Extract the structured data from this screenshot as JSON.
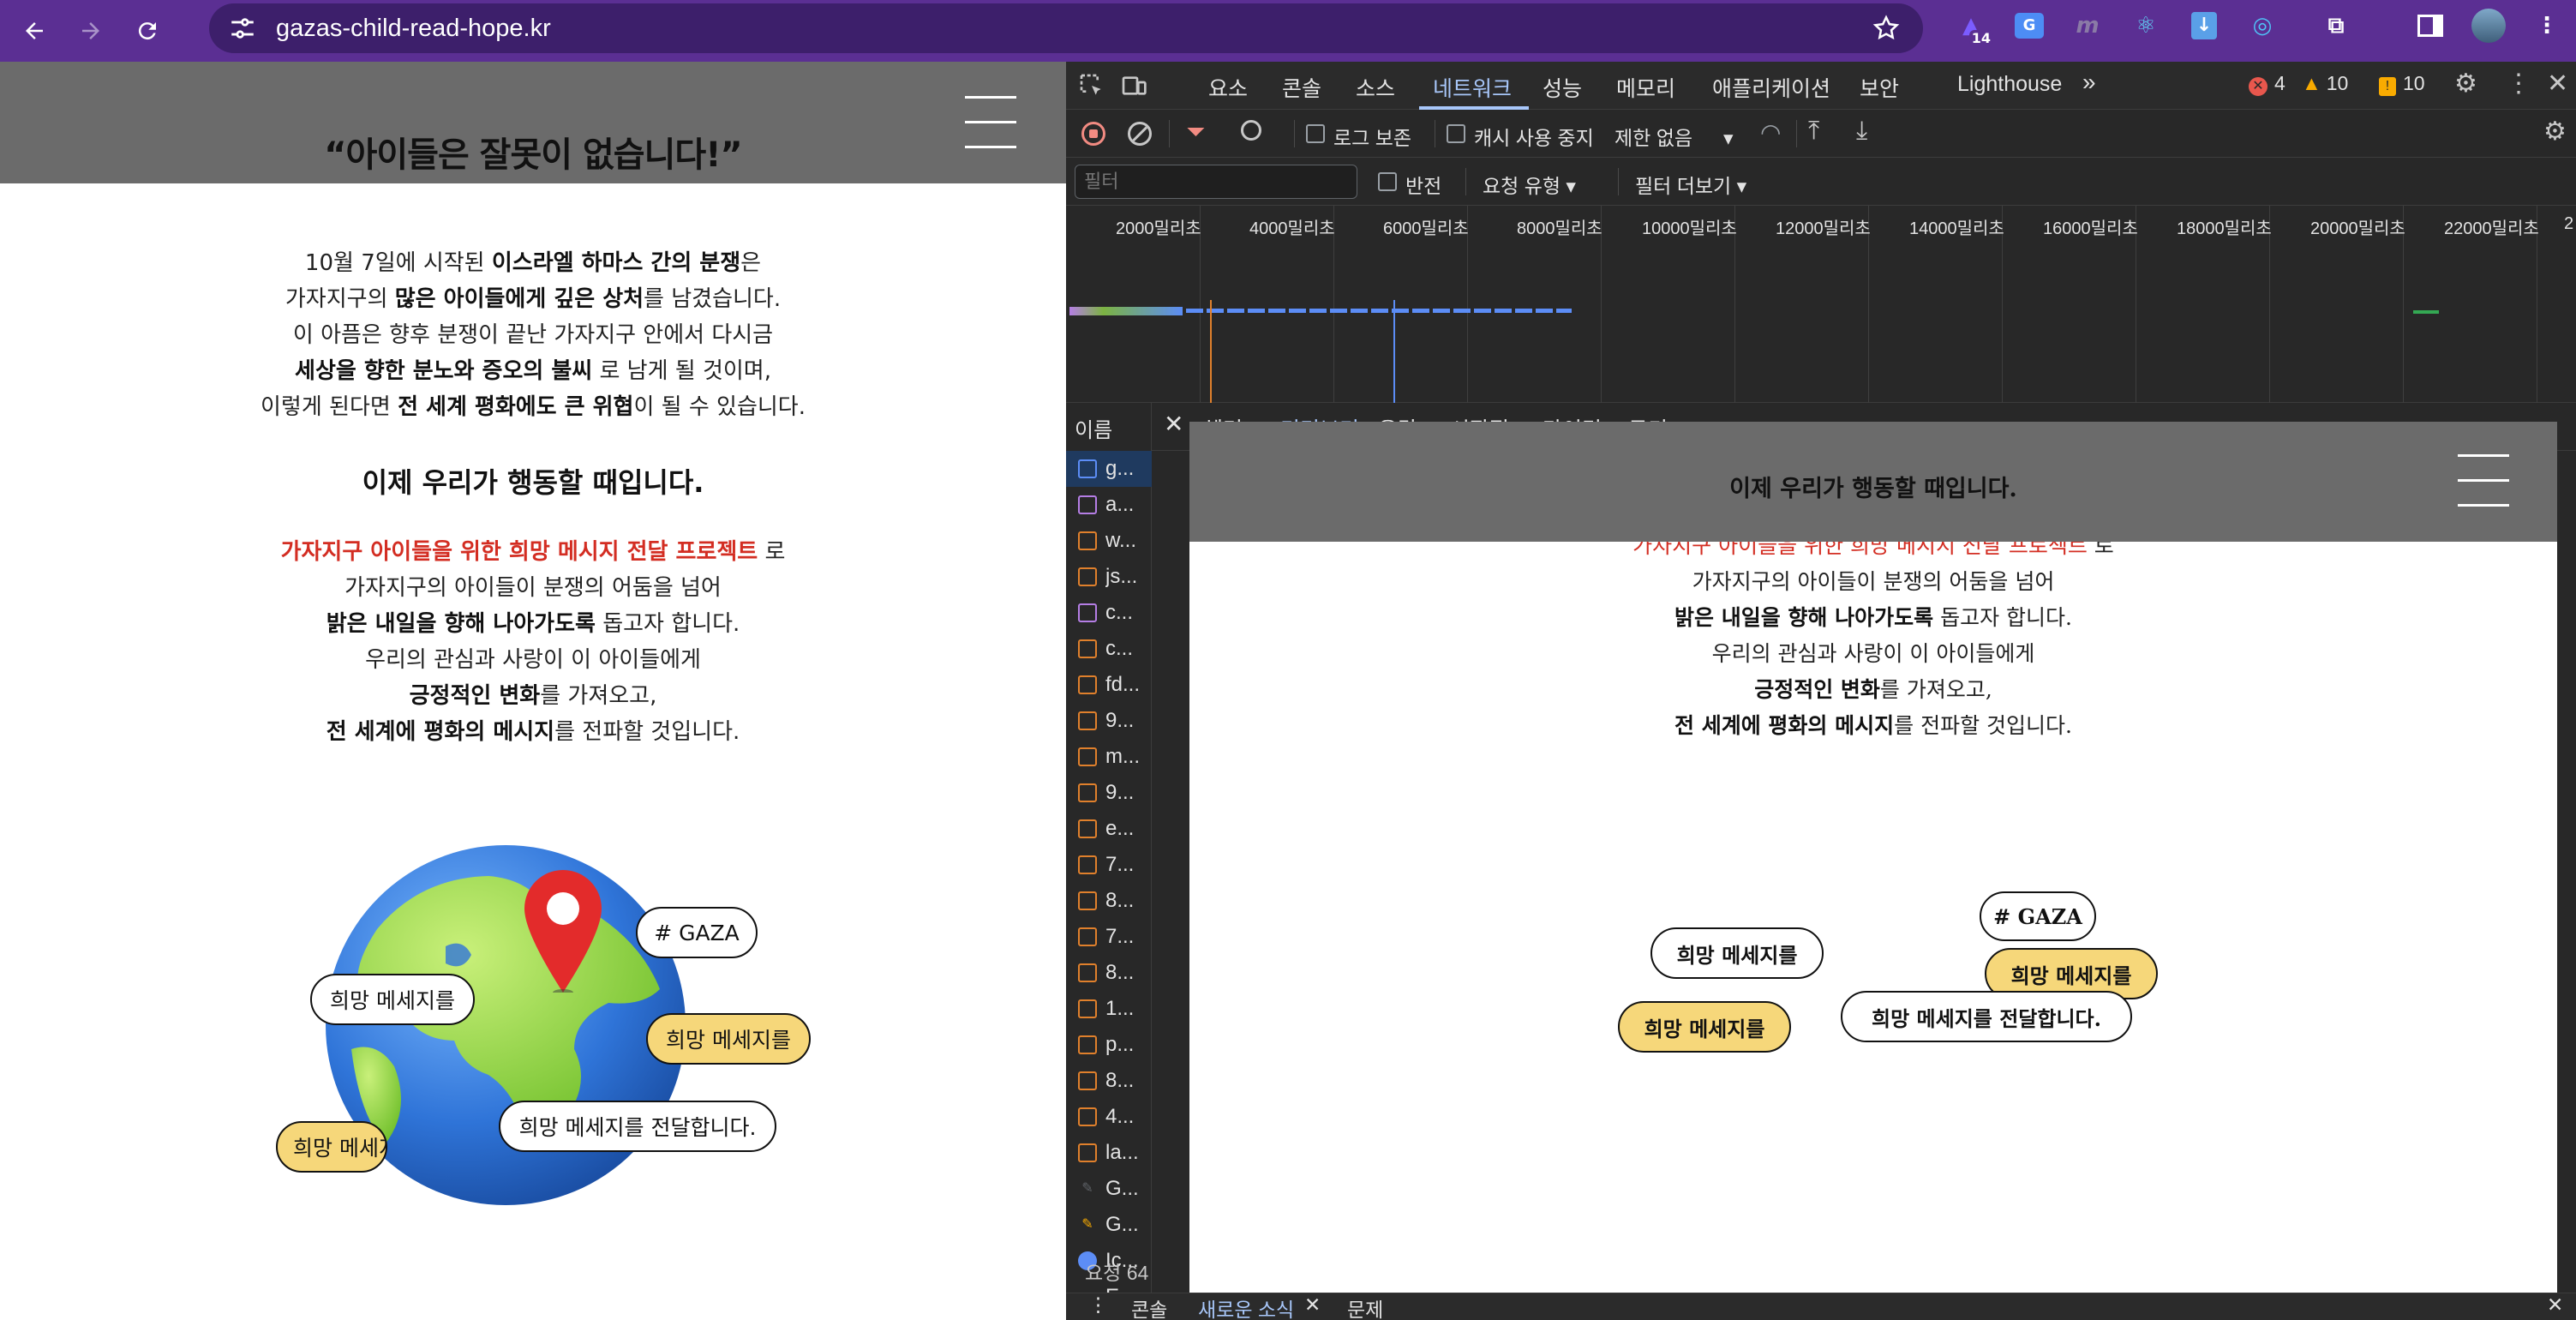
{
  "browser": {
    "url": "gazas-child-read-hope.kr",
    "extension_badge": "14",
    "extension_m": "m"
  },
  "page": {
    "title": "“아이들은 잘못이 없습니다!”",
    "intro": {
      "l1_pre": "10월 7일에 시작된 ",
      "l1_bold": "이스라엘 하마스 간의 분쟁",
      "l1_post": "은",
      "l2_pre": "가자지구의 ",
      "l2_bold": "많은 아이들에게 깊은 상처",
      "l2_post": "를 남겼습니다.",
      "l3": "이 아픔은 향후 분쟁이 끝난 가자지구 안에서 다시금",
      "l4_bold": "세상을 향한 분노와 증오의 불씨",
      "l4_post": " 로 남게 될 것이며,",
      "l5_pre": "이렇게 된다면 ",
      "l5_bold": "전 세계 평화에도 큰 위협",
      "l5_post": "이 될 수 있습니다."
    },
    "call_to_action": "이제 우리가 행동할 때입니다.",
    "project": {
      "l1_red": "가자지구 아이들을 위한 희망 메시지 전달 프로젝트",
      "l1_post": " 로",
      "l2": "가자지구의 아이들이 분쟁의 어둠을 넘어",
      "l3_bold": "밝은 내일을 향해 나아가도록",
      "l3_post": " 돕고자 합니다.",
      "l4": "우리의 관심과 사랑이 이 아이들에게",
      "l5_bold": "긍정적인 변화",
      "l5_post": "를 가져오고,",
      "l6_bold": "전 세계에 평화의 메시지",
      "l6_post": "를 전파할 것입니다."
    },
    "bubbles": {
      "gaza": "# GAZA",
      "hope_left": "희망 메세지를",
      "hope_yellow_right": "희망 메세지를",
      "hope_deliver": "희망 메세지를 전달합니다.",
      "hope_yellow_left": "희망 메세지를"
    }
  },
  "devtools": {
    "tabs": [
      "요소",
      "콘솔",
      "소스",
      "네트워크",
      "성능",
      "메모리",
      "애플리케이션",
      "보안",
      "Lighthouse"
    ],
    "errors": "4",
    "warnings": "10",
    "issues": "10",
    "toolbar": {
      "preserve_log": "로그 보존",
      "disable_cache": "캐시 사용 중지",
      "throttle": "제한 없음"
    },
    "filterbar": {
      "filter_placeholder": "필터",
      "invert": "반전",
      "request_types": "요청 유형",
      "more_filters": "필터 더보기"
    },
    "timeline_labels": [
      "2000밀리초",
      "4000밀리초",
      "6000밀리초",
      "8000밀리초",
      "10000밀리초",
      "12000밀리초",
      "14000밀리초",
      "16000밀리초",
      "18000밀리초",
      "20000밀리초",
      "22000밀리초"
    ],
    "timeline_label_cut": "2",
    "name_header": "이름",
    "requests": [
      "g...",
      "a...",
      "w...",
      "js...",
      "c...",
      "c...",
      "fd...",
      "9...",
      "m...",
      "9...",
      "e...",
      "7...",
      "8...",
      "7...",
      "8...",
      "1...",
      "p...",
      "8...",
      "4...",
      "la...",
      "G...",
      "G...",
      "Ic...",
      "E..."
    ],
    "request_count": "요청 64",
    "detail_tabs": [
      "헤더",
      "미리보기",
      "응답",
      "시작점",
      "타이밍",
      "쿠키"
    ],
    "preview": {
      "title": "이제 우리가 행동할 때입니다.",
      "l1_red": "가자지구 아이들을 위한 희망 메시지 전달 프로젝트",
      "l1_post": " 로",
      "l2": "가자지구의 아이들이 분쟁의 어둠을 넘어",
      "l3_bold": "밝은 내일을 향해 나아가도록",
      "l3_post": " 돕고자 합니다.",
      "l4": "우리의 관심과 사랑이 이 아이들에게",
      "l5_bold": "긍정적인 변화",
      "l5_post": "를 가져오고,",
      "l6_bold": "전 세계에 평화의 메시지",
      "l6_post": "를 전파할 것입니다.",
      "bubble_gaza": "# GAZA",
      "bubble_hope_left": "희망 메세지를",
      "bubble_hope_yellow_right": "희망 메세지를",
      "bubble_hope_yellow_left": "희망 메세지를",
      "bubble_deliver": "희망 메세지를 전달합니다."
    },
    "drawer": [
      "콘솔",
      "새로운 소식",
      "문제"
    ]
  },
  "colors": {
    "browser_frame": "#5b2f93",
    "header_gray": "#6b6b6b",
    "accent_red": "#d32d22",
    "bubble_yellow": "#f6d77a",
    "devtools_blue": "#a8c7fa"
  }
}
